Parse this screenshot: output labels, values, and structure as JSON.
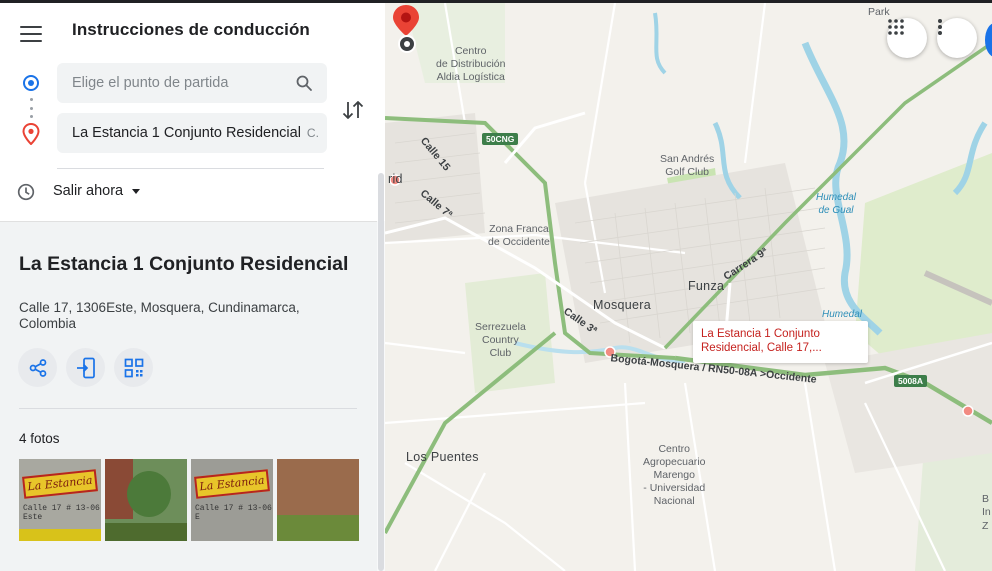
{
  "panel": {
    "title": "Instrucciones de conducción",
    "start_placeholder": "Elige el punto de partida",
    "destination_name": "La Estancia 1 Conjunto Residencial",
    "destination_rest": "C.",
    "depart_label": "Salir ahora"
  },
  "place": {
    "name": "La Estancia 1 Conjunto Residencial",
    "address": "Calle 17, 1306Este, Mosquera, Cundinamarca, Colombia",
    "photos_label": "4 fotos",
    "photo1_sign": "La Estancia",
    "photo1_text": "Calle 17 # 13-06 Este",
    "photo3_sign": "La Estancia",
    "photo3_text": "Calle 17 # 13-06 E"
  },
  "map": {
    "labels": {
      "park": "Park",
      "centro_dist_1": "Centro",
      "centro_dist_2": "de Distribución",
      "centro_dist_3": "Aldia Logística",
      "shield_50cng": "50CNG",
      "calle15": "Calle 15",
      "calle7": "Calle 7ª",
      "rid": "rid",
      "san_andres_1": "San Andrés",
      "san_andres_2": "Golf Club",
      "humedal_gual_1": "Humedal",
      "humedal_gual_2": "de Gual",
      "zona_franca_1": "Zona Franca",
      "zona_franca_2": "de Occidente",
      "carrera9": "Carrera 9ª",
      "mosquera": "Mosquera",
      "funza": "Funza",
      "humedal": "Humedal",
      "serrezuela_1": "Serrezuela",
      "serrezuela_2": "Country",
      "serrezuela_3": "Club",
      "calle3": "Calle 3ª",
      "highway": "Bogotá-Mosquera / RN50-08A >Occidente",
      "shield_5008a": "5008A",
      "los_puentes": "Los Puentes",
      "centro_agro_1": "Centro",
      "centro_agro_2": "Agropecuario",
      "centro_agro_3": "Marengo",
      "centro_agro_4": "- Universidad",
      "centro_agro_5": "Nacional",
      "edge_b": "B",
      "edge_in": "In",
      "edge_z": "Z"
    },
    "callout_line1": "La Estancia 1 Conjunto",
    "callout_line2": "Residencial, Calle 17,..."
  },
  "colors": {
    "accent_blue": "#1a73e8",
    "pin_red": "#ea4335",
    "highway_green": "#7fb069",
    "water": "#9fd3e6",
    "park_green": "#c9e4b2"
  },
  "icons": [
    "menu-icon",
    "search-icon",
    "swap-icon",
    "clock-icon",
    "share-icon",
    "send-to-phone-icon",
    "qr-code-icon",
    "apps-grid-icon",
    "more-vert-icon",
    "destination-pin-icon"
  ]
}
